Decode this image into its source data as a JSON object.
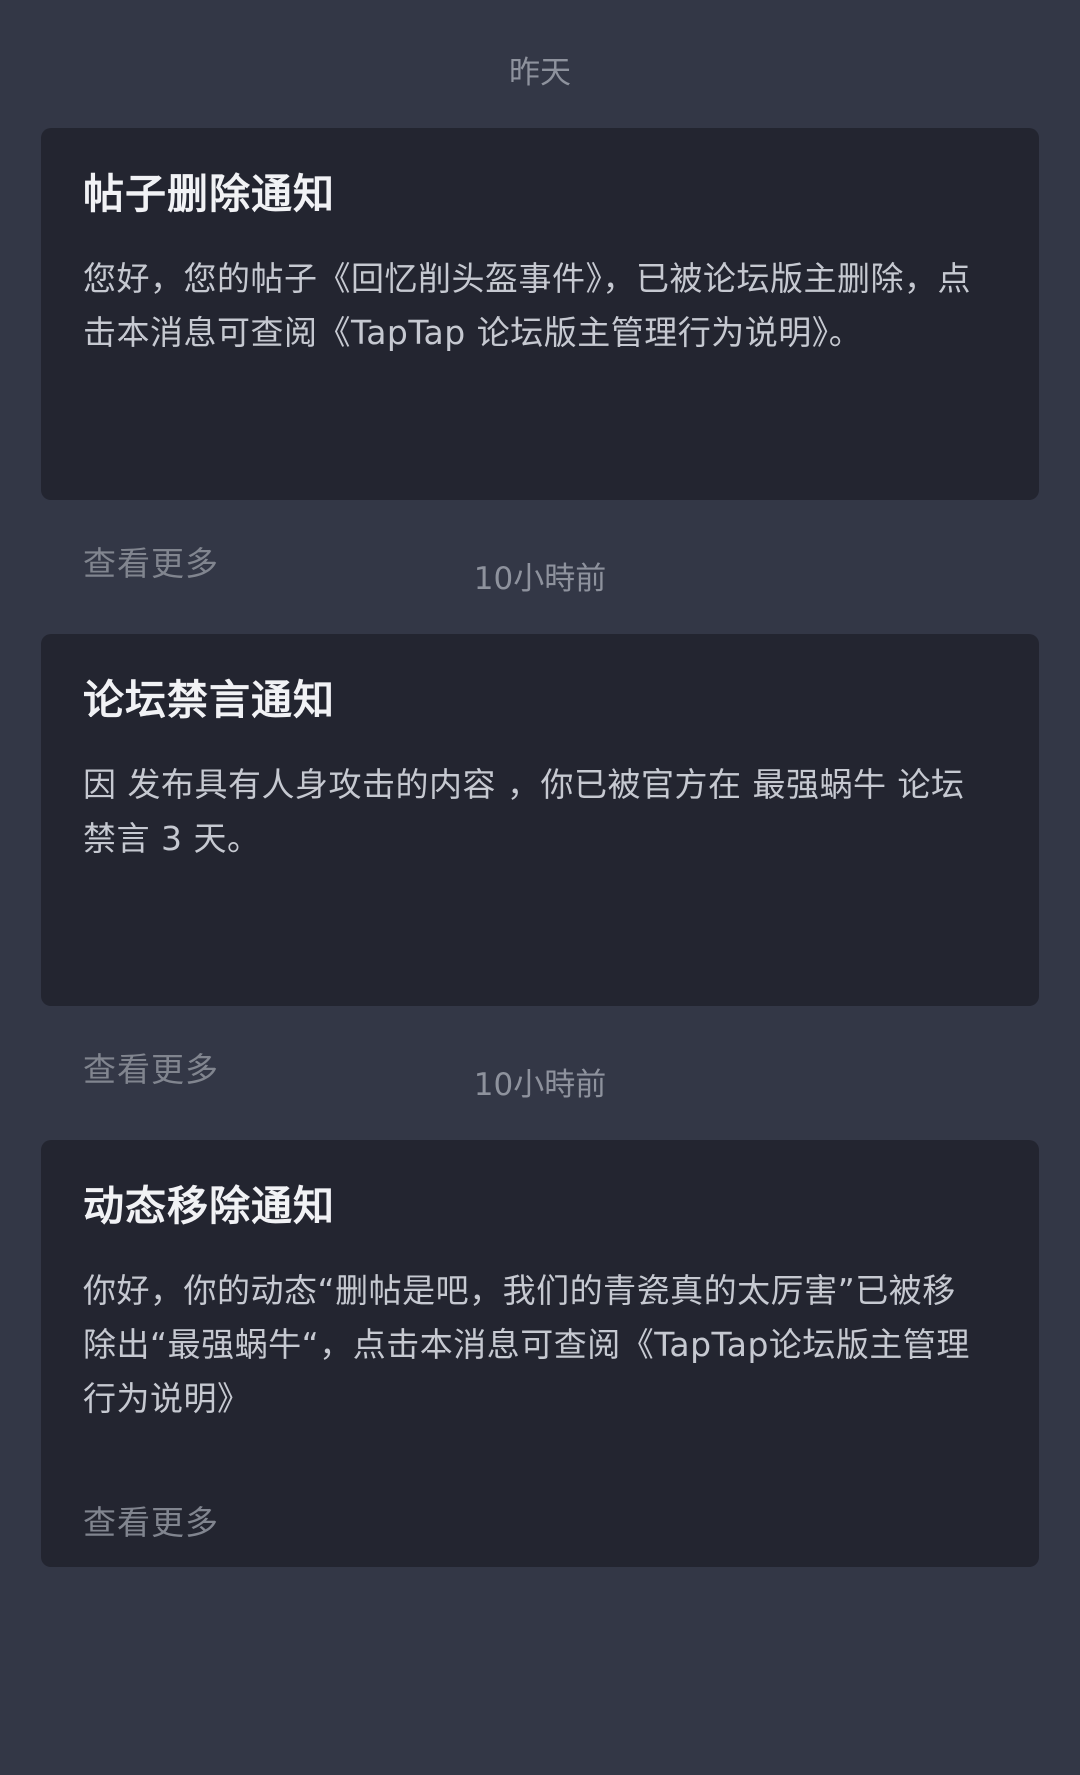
{
  "notifications": [
    {
      "time": "昨天",
      "title": "帖子删除通知",
      "body": "您好，您的帖子《回忆削头盔事件》，已被论坛版主删除，点击本消息可查阅《TapTap 论坛版主管理行为说明》。",
      "more": "查看更多"
    },
    {
      "time": "10小時前",
      "title": "论坛禁言通知",
      "body": "因 发布具有人身攻击的内容 ，你已被官方在 最强蜗牛 论坛禁言 3 天。",
      "more": "查看更多"
    },
    {
      "time": "10小時前",
      "title": "动态移除通知",
      "body": "你好，你的动态“删帖是吧，我们的青瓷真的太厉害”已被移除出“最强蜗牛“，点击本消息可查阅《TapTap论坛版主管理行为说明》",
      "more": "查看更多"
    }
  ]
}
